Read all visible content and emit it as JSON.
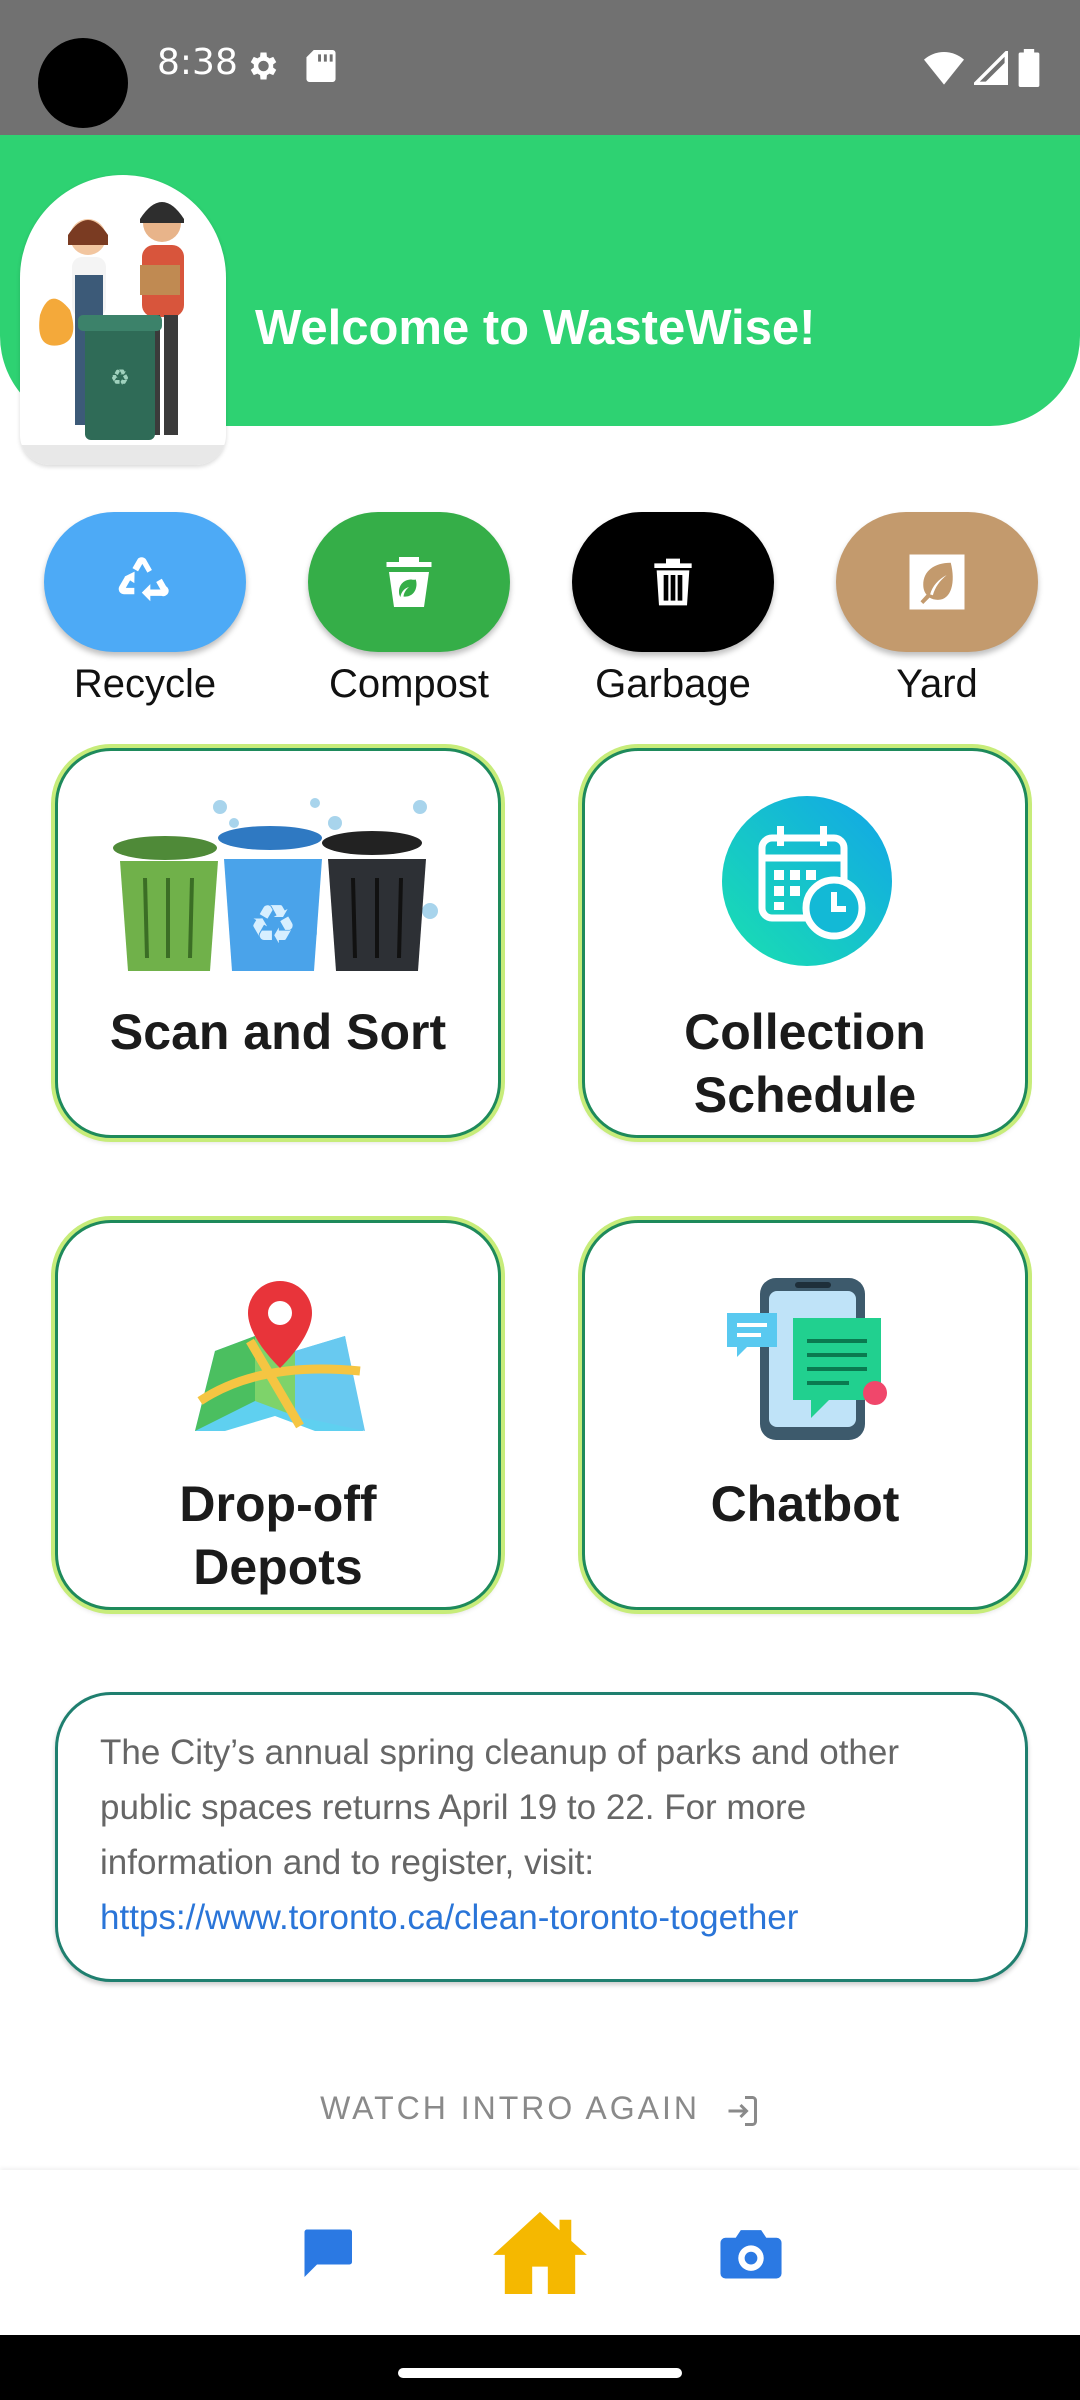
{
  "status_bar": {
    "time": "8:38"
  },
  "header": {
    "welcome": "Welcome to WasteWise!"
  },
  "categories": [
    {
      "label": "Recycle",
      "color": "#4daaf6",
      "icon": "recycle-icon"
    },
    {
      "label": "Compost",
      "color": "#35ae48",
      "icon": "compost-bin-icon"
    },
    {
      "label": "Garbage",
      "color": "#000000",
      "icon": "trash-can-icon"
    },
    {
      "label": "Yard",
      "color": "#c39a6d",
      "icon": "leaf-icon"
    }
  ],
  "cards": [
    {
      "title": "Scan and Sort",
      "icon": "bins-illustration"
    },
    {
      "title_line1": "Collection",
      "title_line2": "Schedule",
      "icon": "calendar-clock-icon"
    },
    {
      "title_line1": "Drop-off",
      "title_line2": "Depots",
      "icon": "map-pin-icon"
    },
    {
      "title": "Chatbot",
      "icon": "phone-chat-icon"
    }
  ],
  "news": {
    "text": "The City’s annual spring cleanup of parks and other public spaces returns April 19 to 22. For more information and to register, visit: ",
    "link": "https://www.toronto.ca/clean-toronto-together"
  },
  "intro_button": "WATCH INTRO AGAIN",
  "nav": [
    {
      "icon": "chat-icon",
      "color": "#2b79e3"
    },
    {
      "icon": "home-icon",
      "color": "#f5b800"
    },
    {
      "icon": "camera-icon",
      "color": "#2b79e3"
    }
  ]
}
